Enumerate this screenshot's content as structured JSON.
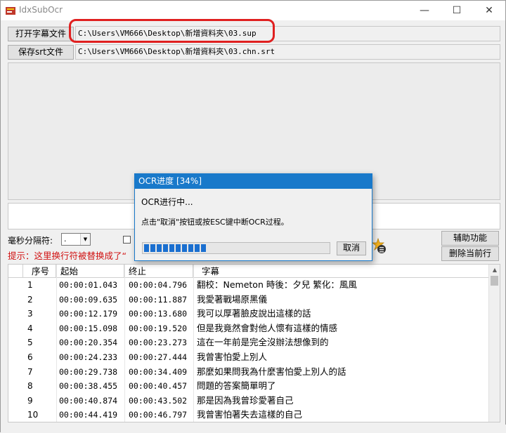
{
  "window": {
    "title": "IdxSubOcr",
    "min_glyph": "—",
    "max_glyph": "☐",
    "close_glyph": "✕"
  },
  "files": {
    "open_sub_label": "打开字幕文件",
    "open_sub_path": "C:\\Users\\VM666\\Desktop\\新增資料夾\\03.sup",
    "save_srt_label": "保存srt文件",
    "save_srt_path": "C:\\Users\\VM666\\Desktop\\新增資料夾\\03.chn.srt"
  },
  "options": {
    "ms_separator_label": "毫秒分隔符:",
    "ms_separator_value": ".",
    "hint": "提示：这里换行符被替换成了“",
    "assist_button": "辅助功能",
    "delete_row_button": "删除当前行"
  },
  "table": {
    "headers": [
      "序号",
      "起始",
      "终止",
      "字幕"
    ],
    "rows": [
      {
        "no": "1",
        "start": "00:00:01.043",
        "end": "00:00:04.796",
        "text": "翻校：Nemeton 時後：夕兒 繁化：風風"
      },
      {
        "no": "2",
        "start": "00:00:09.635",
        "end": "00:00:11.887",
        "text": "我愛著戰場原黑儀"
      },
      {
        "no": "3",
        "start": "00:00:12.179",
        "end": "00:00:13.680",
        "text": "我可以厚著臉皮說出這樣的話"
      },
      {
        "no": "4",
        "start": "00:00:15.098",
        "end": "00:00:19.520",
        "text": "但是我竟然會對他人懷有這樣的情感"
      },
      {
        "no": "5",
        "start": "00:00:20.354",
        "end": "00:00:23.273",
        "text": "這在一年前是完全沒辦法想像到的"
      },
      {
        "no": "6",
        "start": "00:00:24.233",
        "end": "00:00:27.444",
        "text": "我曾害怕愛上別人"
      },
      {
        "no": "7",
        "start": "00:00:29.738",
        "end": "00:00:34.409",
        "text": "那麼如果問我為什麼害怕愛上別人的話"
      },
      {
        "no": "8",
        "start": "00:00:38.455",
        "end": "00:00:40.457",
        "text": "問題的答案簡單明了"
      },
      {
        "no": "9",
        "start": "00:00:40.874",
        "end": "00:00:43.502",
        "text": "那是因為我曾珍愛著自己"
      },
      {
        "no": "10",
        "start": "00:00:44.419",
        "end": "00:00:46.797",
        "text": "我曾害怕著失去這樣的自己"
      }
    ]
  },
  "dialog": {
    "title": "OCR进度 [34%]",
    "status": "OCR进行中...",
    "instruction": "点击\"取消\"按钮或按ESC键中断OCR过程。",
    "progress": 0.34,
    "cancel_label": "取消"
  },
  "colors": {
    "accent": "#1979ca",
    "hint_red": "#d01010",
    "highlight_red": "#e02020",
    "progress_fill": "#1a6fd0"
  }
}
